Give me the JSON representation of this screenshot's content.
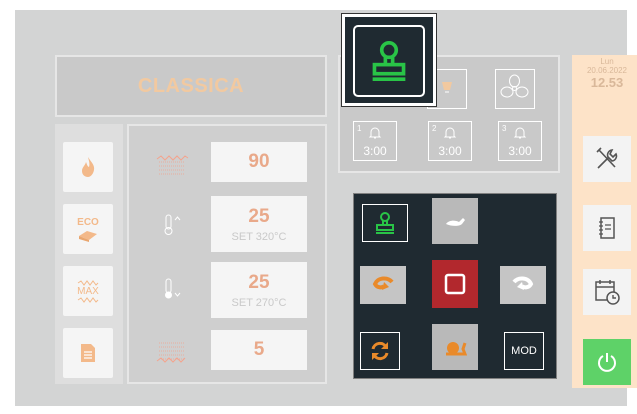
{
  "mode_title": "CLASSICA",
  "clock": {
    "day": "Lun",
    "date": "20.06.2022",
    "time": "12.53"
  },
  "left_buttons": [
    "flame-icon",
    "eco-icon",
    "max-icon",
    "document-icon"
  ],
  "eco_label": "ECO",
  "max_label": "MAX",
  "values": [
    {
      "value": "90",
      "set": ""
    },
    {
      "value": "25",
      "set": "SET 320°C"
    },
    {
      "value": "25",
      "set": "SET 270°C"
    },
    {
      "value": "5",
      "set": ""
    }
  ],
  "timers": [
    {
      "num": "1",
      "time": "3:00"
    },
    {
      "num": "2",
      "time": "3:00"
    },
    {
      "num": "3",
      "time": "3:00"
    }
  ],
  "controls": {
    "mod_label": "MOD"
  },
  "colors": {
    "accent_green": "#29c447",
    "stop_red": "#b2282d",
    "orange": "#e98a2a",
    "power_green": "#5ed268"
  }
}
